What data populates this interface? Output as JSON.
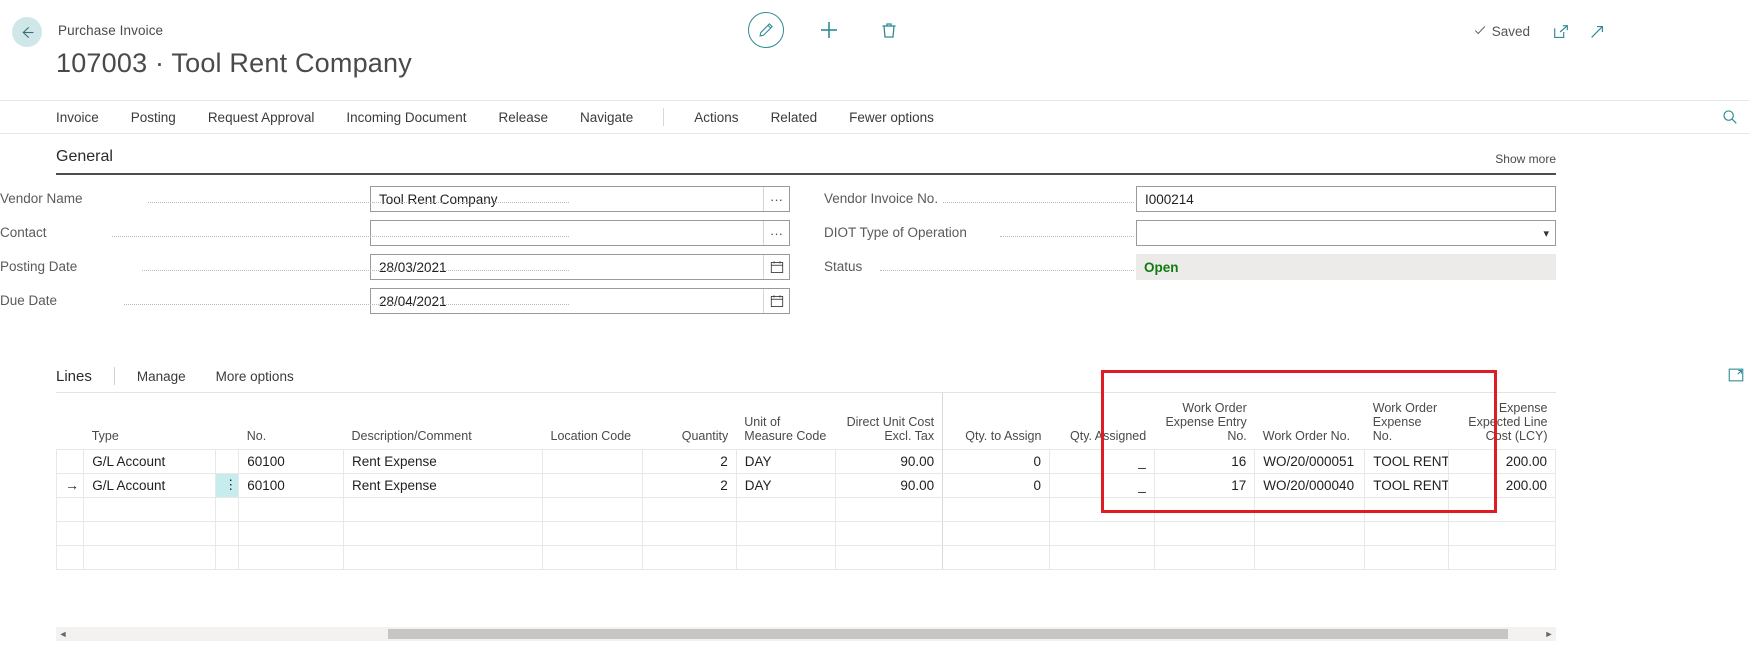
{
  "header": {
    "breadcrumb": "Purchase Invoice",
    "title": "107003 · Tool Rent Company",
    "back_label": "Back",
    "edit_label": "Edit",
    "new_label": "New",
    "delete_label": "Delete",
    "saved_label": "Saved",
    "open_in_new_label": "Open in new window",
    "expand_label": "Expand",
    "search_label": "Search"
  },
  "menu": {
    "items": [
      {
        "label": "Invoice"
      },
      {
        "label": "Posting"
      },
      {
        "label": "Request Approval"
      },
      {
        "label": "Incoming Document"
      },
      {
        "label": "Release"
      },
      {
        "label": "Navigate"
      },
      {
        "label": "Actions"
      },
      {
        "label": "Related"
      },
      {
        "label": "Fewer options"
      }
    ]
  },
  "general": {
    "title": "General",
    "show_more": "Show more",
    "left_fields": [
      {
        "label": "Vendor Name",
        "value": "Tool Rent Company",
        "assist": "···",
        "type": "lookup"
      },
      {
        "label": "Contact",
        "value": "",
        "assist": "···",
        "type": "lookup"
      },
      {
        "label": "Posting Date",
        "value": "28/03/2021",
        "type": "date"
      },
      {
        "label": "Due Date",
        "value": "28/04/2021",
        "type": "date"
      }
    ],
    "right_fields": [
      {
        "label": "Vendor Invoice No.",
        "value": "I000214",
        "type": "text"
      },
      {
        "label": "DIOT Type of Operation",
        "value": "",
        "type": "select"
      },
      {
        "label": "Status",
        "value": "Open",
        "type": "status"
      }
    ],
    "status_color": "#107c10"
  },
  "lines": {
    "title": "Lines",
    "manage_label": "Manage",
    "more_options_label": "More options",
    "expand_label": "Open in full screen",
    "columns": [
      {
        "key": "selector",
        "label": "",
        "align": "left"
      },
      {
        "key": "type",
        "label": "Type",
        "align": "left"
      },
      {
        "key": "dots",
        "label": "",
        "align": "center"
      },
      {
        "key": "no",
        "label": "No.",
        "align": "left"
      },
      {
        "key": "description",
        "label": "Description/Comment",
        "align": "left"
      },
      {
        "key": "location_code",
        "label": "Location Code",
        "align": "left"
      },
      {
        "key": "quantity",
        "label": "Quantity",
        "align": "right"
      },
      {
        "key": "uom",
        "label": "Unit of\nMeasure Code",
        "align": "left"
      },
      {
        "key": "direct_unit_cost",
        "label": "Direct Unit Cost\nExcl. Tax",
        "align": "right"
      },
      {
        "key": "qty_to_assign",
        "label": "Qty. to Assign",
        "align": "right"
      },
      {
        "key": "qty_assigned",
        "label": "Qty. Assigned",
        "align": "right"
      },
      {
        "key": "wo_expense_entry_no",
        "label": "Work Order\nExpense Entry\nNo.",
        "align": "right"
      },
      {
        "key": "wo_no",
        "label": "Work Order No.",
        "align": "left"
      },
      {
        "key": "wo_expense_no",
        "label": "Work Order\nExpense No.",
        "align": "left"
      },
      {
        "key": "expense_expected_line_cost",
        "label": "Expense\nExpected Line\nCost (LCY)",
        "align": "right"
      }
    ],
    "rows": [
      {
        "selector": "",
        "type": "G/L Account",
        "dots": "",
        "no": "60100",
        "description": "Rent Expense",
        "location_code": "",
        "quantity": "2",
        "uom": "DAY",
        "direct_unit_cost": "90.00",
        "qty_to_assign": "0",
        "qty_assigned": "_",
        "wo_expense_entry_no": "16",
        "wo_no": "WO/20/000051",
        "wo_expense_no": "TOOL RENT",
        "expense_expected_line_cost": "200.00",
        "selected": false
      },
      {
        "selector": "→",
        "type": "G/L Account",
        "dots": "⋮",
        "no": "60100",
        "description": "Rent Expense",
        "location_code": "",
        "quantity": "2",
        "uom": "DAY",
        "direct_unit_cost": "90.00",
        "qty_to_assign": "0",
        "qty_assigned": "_",
        "wo_expense_entry_no": "17",
        "wo_no": "WO/20/000040",
        "wo_expense_no": "TOOL RENT",
        "expense_expected_line_cost": "200.00",
        "selected": true
      },
      {
        "selector": "",
        "type": "",
        "dots": "",
        "no": "",
        "description": "",
        "location_code": "",
        "quantity": "",
        "uom": "",
        "direct_unit_cost": "",
        "qty_to_assign": "",
        "qty_assigned": "",
        "wo_expense_entry_no": "",
        "wo_no": "",
        "wo_expense_no": "",
        "expense_expected_line_cost": "",
        "selected": false
      },
      {
        "selector": "",
        "type": "",
        "dots": "",
        "no": "",
        "description": "",
        "location_code": "",
        "quantity": "",
        "uom": "",
        "direct_unit_cost": "",
        "qty_to_assign": "",
        "qty_assigned": "",
        "wo_expense_entry_no": "",
        "wo_no": "",
        "wo_expense_no": "",
        "expense_expected_line_cost": "",
        "selected": false
      },
      {
        "selector": "",
        "type": "",
        "dots": "",
        "no": "",
        "description": "",
        "location_code": "",
        "quantity": "",
        "uom": "",
        "direct_unit_cost": "",
        "qty_to_assign": "",
        "qty_assigned": "",
        "wo_expense_entry_no": "",
        "wo_no": "",
        "wo_expense_no": "",
        "expense_expected_line_cost": "",
        "selected": false
      }
    ],
    "highlight_color": "#e01b24",
    "selected_cell_color": "#c7eced"
  },
  "scrollbar": {
    "left_arrow": "◄",
    "right_arrow": "►"
  }
}
